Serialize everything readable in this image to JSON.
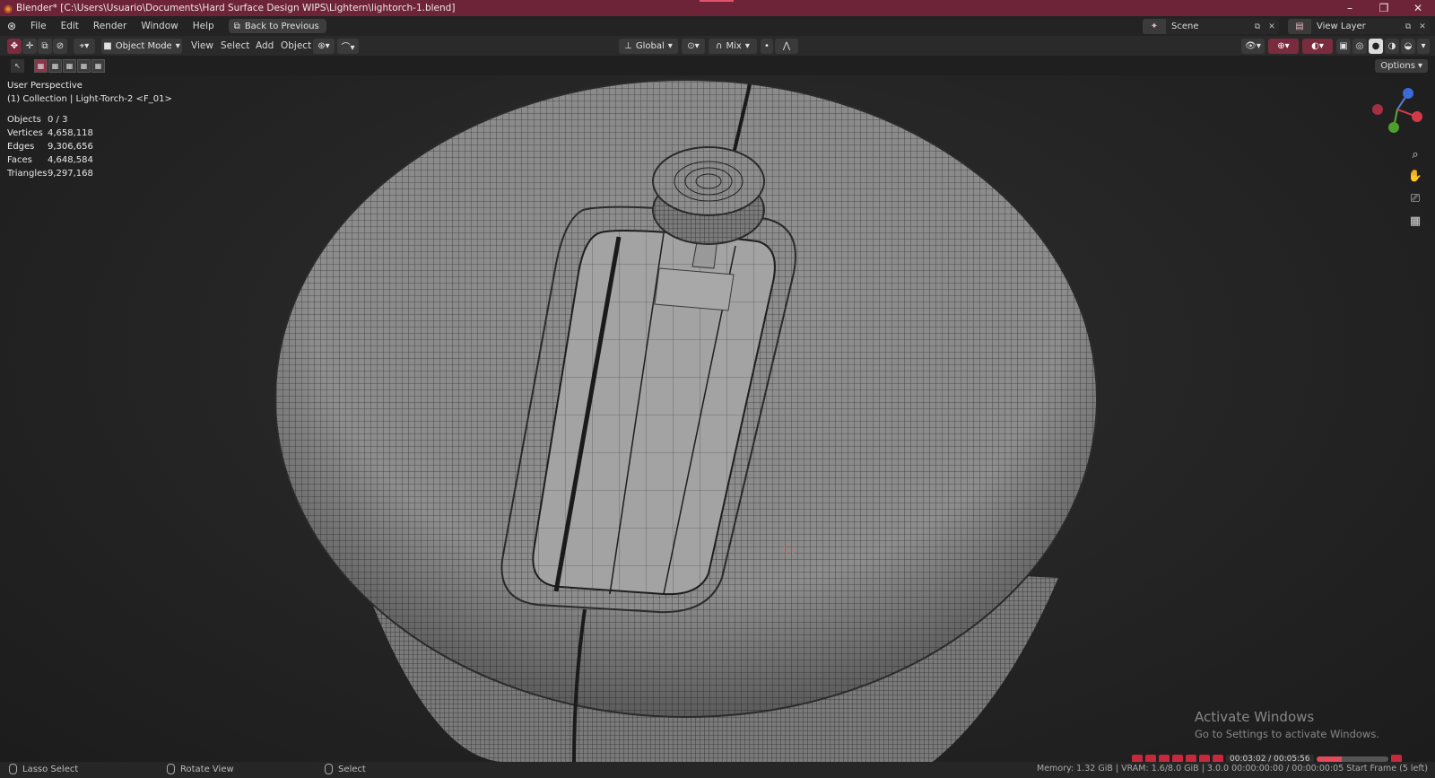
{
  "window": {
    "title": "Blender* [C:\\Users\\Usuario\\Documents\\Hard Surface Design WIPS\\Lightern\\lightorch-1.blend]",
    "accent_color": "#6d2438"
  },
  "menubar": {
    "items": [
      "File",
      "Edit",
      "Render",
      "Window",
      "Help"
    ],
    "back_button": "Back to Previous",
    "scene": "Scene",
    "view_layer": "View Layer"
  },
  "header": {
    "mode": "Object Mode",
    "menus": [
      "View",
      "Select",
      "Add",
      "Object"
    ],
    "transform_orientation": "Global",
    "pivot_mix": "Mix"
  },
  "subbar": {
    "options": "Options"
  },
  "viewport": {
    "perspective": "User Perspective",
    "collection": "(1) Collection | Light-Torch-2 <F_01>",
    "stats": [
      {
        "label": "Objects",
        "value": "0 / 3"
      },
      {
        "label": "Vertices",
        "value": "4,658,118"
      },
      {
        "label": "Edges",
        "value": "9,306,656"
      },
      {
        "label": "Faces",
        "value": "4,648,584"
      },
      {
        "label": "Triangles",
        "value": "9,297,168"
      }
    ]
  },
  "watermark": {
    "line1": "Activate Windows",
    "line2": "Go to Settings to activate Windows."
  },
  "timeline": {
    "time": "00:03:02 / 00:05:56",
    "progress": 0.36
  },
  "statusbar": {
    "lasso": "Lasso Select",
    "rotate": "Rotate View",
    "select": "Select",
    "info": "Memory: 1.32 GiB | VRAM: 1.6/8.0 GiB | 3.0.0   00:00:00:00 / 00:00:00:05   Start Frame (5 left)"
  }
}
